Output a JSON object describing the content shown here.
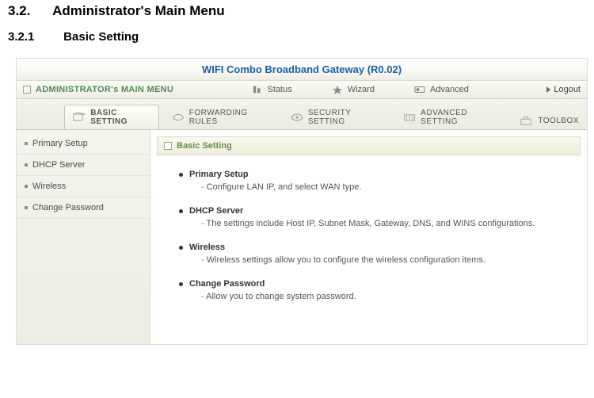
{
  "doc": {
    "sec1_num": "3.2.",
    "sec1_title": "Administrator's Main Menu",
    "sec2_num": "3.2.1",
    "sec2_title": "Basic Setting"
  },
  "title": "WIFI Combo Broadband Gateway (R0.02)",
  "topbar": {
    "menu_label": "ADMINISTRATOR's MAIN MENU",
    "items": [
      {
        "label": "Status"
      },
      {
        "label": "Wizard"
      },
      {
        "label": "Advanced"
      }
    ],
    "logout_label": "Logout"
  },
  "tabs": [
    {
      "label": "BASIC SETTING",
      "active": true
    },
    {
      "label": "FORWARDING RULES",
      "active": false
    },
    {
      "label": "SECURITY SETTING",
      "active": false
    },
    {
      "label": "ADVANCED SETTING",
      "active": false
    },
    {
      "label": "TOOLBOX",
      "active": false
    }
  ],
  "sidebar": {
    "items": [
      {
        "label": "Primary Setup"
      },
      {
        "label": "DHCP Server"
      },
      {
        "label": "Wireless"
      },
      {
        "label": "Change Password"
      }
    ]
  },
  "panel": {
    "heading": "Basic Setting",
    "items": [
      {
        "title": "Primary Setup",
        "desc": "Configure LAN IP, and select WAN type."
      },
      {
        "title": "DHCP Server",
        "desc": "The settings include Host IP, Subnet Mask, Gateway, DNS, and WINS configurations."
      },
      {
        "title": "Wireless",
        "desc": "Wireless settings allow you to configure the wireless configuration items."
      },
      {
        "title": "Change Password",
        "desc": "Allow you to change system password."
      }
    ]
  }
}
